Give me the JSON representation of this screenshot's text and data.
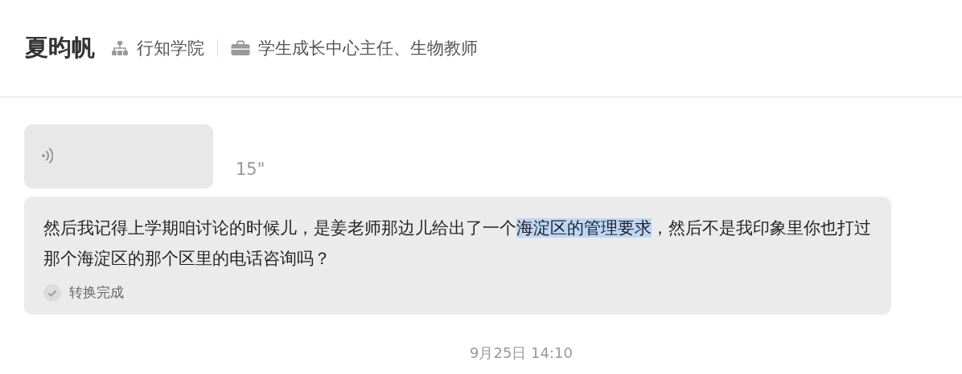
{
  "header": {
    "name": "夏昀帆",
    "org": "行知学院",
    "role": "学生成长中心主任、生物教师"
  },
  "voice_message": {
    "duration": "15\""
  },
  "transcript": {
    "segments": [
      {
        "text": "然后我记得上学期咱讨论的时候儿，是姜老师那边儿给出了一个",
        "selected": false
      },
      {
        "text": "海淀区的管理要求",
        "selected": true
      },
      {
        "text": "，然后不是我印象里你也打过那个海淀区的那个区里的电话咨询吗？",
        "selected": false
      }
    ],
    "status": "转换完成",
    "done": true
  },
  "timestamp": "9月25日 14:10"
}
